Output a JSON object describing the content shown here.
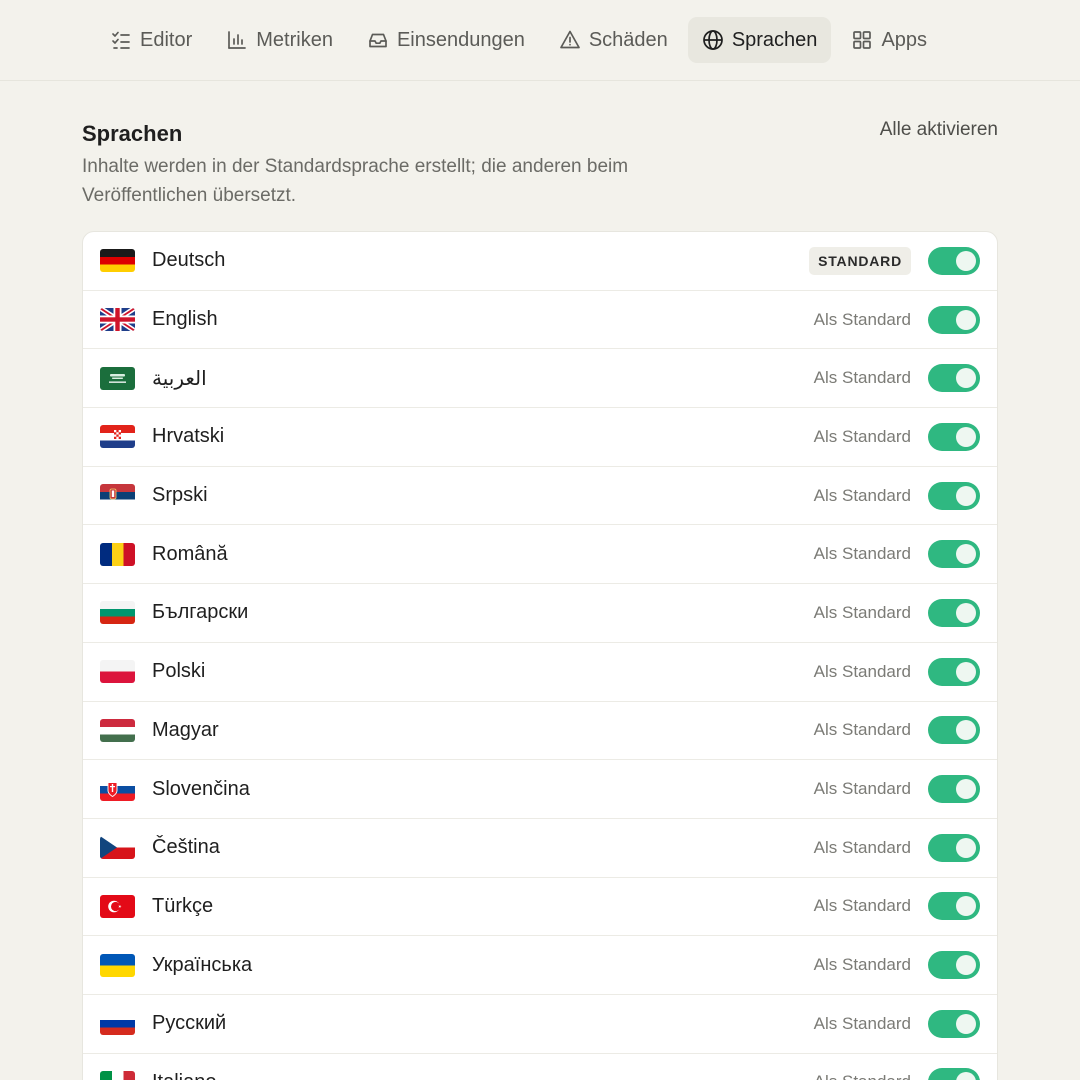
{
  "nav": {
    "tabs": [
      {
        "label": "Editor",
        "icon": "checklist-icon",
        "active": false
      },
      {
        "label": "Metriken",
        "icon": "bar-chart-icon",
        "active": false
      },
      {
        "label": "Einsendungen",
        "icon": "inbox-icon",
        "active": false
      },
      {
        "label": "Schäden",
        "icon": "warning-icon",
        "active": false
      },
      {
        "label": "Sprachen",
        "icon": "globe-icon",
        "active": true
      },
      {
        "label": "Apps",
        "icon": "grid-icon",
        "active": false
      }
    ]
  },
  "header": {
    "title": "Sprachen",
    "description": "Inhalte werden in der Standardsprache erstellt; die anderen beim Veröffentlichen übersetzt.",
    "enable_all": "Alle aktivieren"
  },
  "labels": {
    "default_badge": "STANDARD",
    "make_default": "Als Standard"
  },
  "colors": {
    "toggle_on": "#2fb881",
    "background": "#f3f2ec"
  },
  "languages": [
    {
      "name": "Deutsch",
      "flag": "de-flag",
      "is_default": true,
      "enabled": true
    },
    {
      "name": "English",
      "flag": "gb-flag",
      "is_default": false,
      "enabled": true
    },
    {
      "name": "العربية",
      "flag": "sa-flag",
      "is_default": false,
      "enabled": true
    },
    {
      "name": "Hrvatski",
      "flag": "hr-flag",
      "is_default": false,
      "enabled": true
    },
    {
      "name": "Srpski",
      "flag": "rs-flag",
      "is_default": false,
      "enabled": true
    },
    {
      "name": "Română",
      "flag": "ro-flag",
      "is_default": false,
      "enabled": true
    },
    {
      "name": "Български",
      "flag": "bg-flag",
      "is_default": false,
      "enabled": true
    },
    {
      "name": "Polski",
      "flag": "pl-flag",
      "is_default": false,
      "enabled": true
    },
    {
      "name": "Magyar",
      "flag": "hu-flag",
      "is_default": false,
      "enabled": true
    },
    {
      "name": "Slovenčina",
      "flag": "sk-flag",
      "is_default": false,
      "enabled": true
    },
    {
      "name": "Čeština",
      "flag": "cz-flag",
      "is_default": false,
      "enabled": true
    },
    {
      "name": "Türkçe",
      "flag": "tr-flag",
      "is_default": false,
      "enabled": true
    },
    {
      "name": "Українська",
      "flag": "ua-flag",
      "is_default": false,
      "enabled": true
    },
    {
      "name": "Русский",
      "flag": "ru-flag",
      "is_default": false,
      "enabled": true
    },
    {
      "name": "Italiano",
      "flag": "it-flag",
      "is_default": false,
      "enabled": true
    }
  ]
}
